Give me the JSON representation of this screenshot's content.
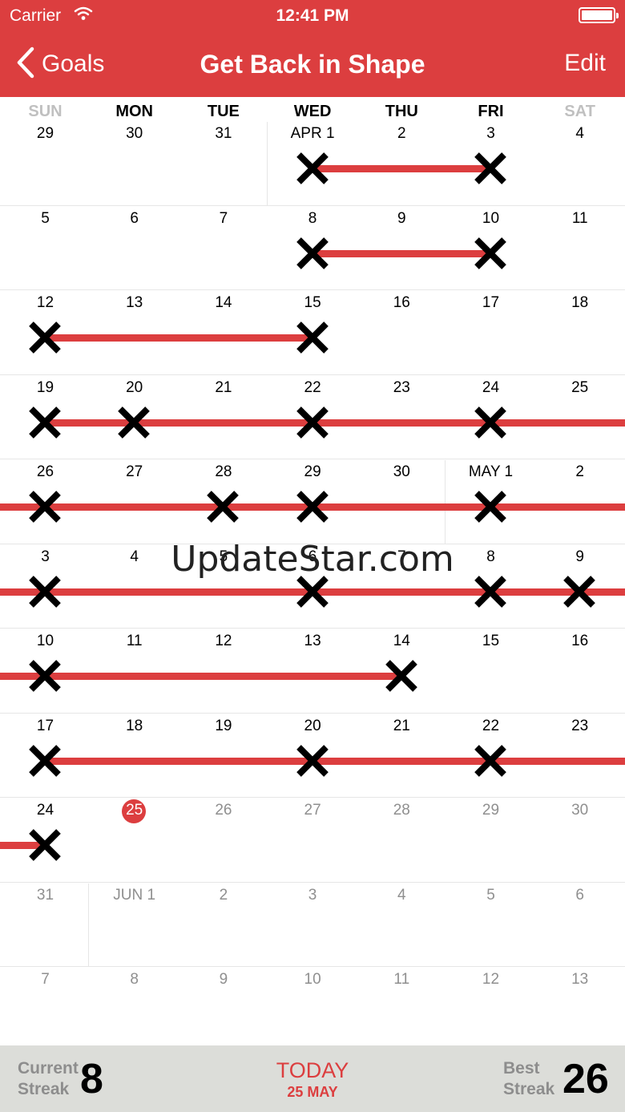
{
  "status_bar": {
    "carrier": "Carrier",
    "time": "12:41 PM"
  },
  "nav": {
    "back_label": "Goals",
    "title": "Get Back in Shape",
    "edit_label": "Edit"
  },
  "weekdays": [
    {
      "label": "SUN",
      "dim": true
    },
    {
      "label": "MON",
      "dim": false
    },
    {
      "label": "TUE",
      "dim": false
    },
    {
      "label": "WED",
      "dim": false
    },
    {
      "label": "THU",
      "dim": false
    },
    {
      "label": "FRI",
      "dim": false
    },
    {
      "label": "SAT",
      "dim": true
    }
  ],
  "calendar": {
    "weeks": [
      {
        "days": [
          "29",
          "30",
          "31",
          "APR 1",
          "2",
          "3",
          "4"
        ],
        "future": [
          false,
          false,
          false,
          false,
          false,
          false,
          false
        ],
        "marked": [
          false,
          false,
          false,
          true,
          false,
          true,
          false
        ]
      },
      {
        "days": [
          "5",
          "6",
          "7",
          "8",
          "9",
          "10",
          "11"
        ],
        "future": [
          false,
          false,
          false,
          false,
          false,
          false,
          false
        ],
        "marked": [
          false,
          false,
          false,
          true,
          false,
          true,
          false
        ]
      },
      {
        "days": [
          "12",
          "13",
          "14",
          "15",
          "16",
          "17",
          "18"
        ],
        "future": [
          false,
          false,
          false,
          false,
          false,
          false,
          false
        ],
        "marked": [
          true,
          false,
          false,
          true,
          false,
          false,
          false
        ]
      },
      {
        "days": [
          "19",
          "20",
          "21",
          "22",
          "23",
          "24",
          "25"
        ],
        "future": [
          false,
          false,
          false,
          false,
          false,
          false,
          false
        ],
        "marked": [
          true,
          true,
          false,
          true,
          false,
          true,
          false
        ]
      },
      {
        "days": [
          "26",
          "27",
          "28",
          "29",
          "30",
          "MAY 1",
          "2"
        ],
        "future": [
          false,
          false,
          false,
          false,
          false,
          false,
          false
        ],
        "marked": [
          true,
          false,
          true,
          true,
          false,
          true,
          false
        ]
      },
      {
        "days": [
          "3",
          "4",
          "5",
          "6",
          "7",
          "8",
          "9"
        ],
        "future": [
          false,
          false,
          false,
          false,
          false,
          false,
          false
        ],
        "marked": [
          true,
          false,
          false,
          true,
          false,
          true,
          true
        ]
      },
      {
        "days": [
          "10",
          "11",
          "12",
          "13",
          "14",
          "15",
          "16"
        ],
        "future": [
          false,
          false,
          false,
          false,
          false,
          false,
          false
        ],
        "marked": [
          true,
          false,
          false,
          false,
          true,
          false,
          false
        ]
      },
      {
        "days": [
          "17",
          "18",
          "19",
          "20",
          "21",
          "22",
          "23"
        ],
        "future": [
          false,
          false,
          false,
          false,
          false,
          false,
          false
        ],
        "marked": [
          true,
          false,
          false,
          true,
          false,
          true,
          false
        ]
      },
      {
        "days": [
          "24",
          "25",
          "26",
          "27",
          "28",
          "29",
          "30"
        ],
        "future": [
          false,
          false,
          true,
          true,
          true,
          true,
          true
        ],
        "marked": [
          true,
          false,
          false,
          false,
          false,
          false,
          false
        ],
        "today_index": 1
      },
      {
        "days": [
          "31",
          "JUN 1",
          "2",
          "3",
          "4",
          "5",
          "6"
        ],
        "future": [
          true,
          true,
          true,
          true,
          true,
          true,
          true
        ],
        "marked": [
          false,
          false,
          false,
          false,
          false,
          false,
          false
        ]
      },
      {
        "days": [
          "7",
          "8",
          "9",
          "10",
          "11",
          "12",
          "13"
        ],
        "future": [
          true,
          true,
          true,
          true,
          true,
          true,
          true
        ],
        "marked": [
          false,
          false,
          false,
          false,
          false,
          false,
          false
        ]
      }
    ],
    "streaks": [
      {
        "week": 0,
        "from": 3,
        "to": 5
      },
      {
        "week": 1,
        "from": 3,
        "to": 5
      },
      {
        "week": 2,
        "from": 0,
        "to": 3
      },
      {
        "week": 3,
        "from": 0,
        "to": 7
      },
      {
        "week": 4,
        "from": -1,
        "to": 7
      },
      {
        "week": 5,
        "from": -1,
        "to": 7
      },
      {
        "week": 6,
        "from": -1,
        "to": 4
      },
      {
        "week": 7,
        "from": 0,
        "to": 7
      },
      {
        "week": 8,
        "from": -1,
        "to": 0
      }
    ]
  },
  "watermark": "UpdateStar.com",
  "footer": {
    "current_label_1": "Current",
    "current_label_2": "Streak",
    "current_value": "8",
    "today_label": "TODAY",
    "today_date": "25 MAY",
    "best_label_1": "Best",
    "best_label_2": "Streak",
    "best_value": "26"
  },
  "colors": {
    "accent": "#dc3e3f",
    "footer_bg": "#dcddd9",
    "future_text": "#8f8f8f"
  },
  "icons": {
    "back": "chevron-left-icon",
    "wifi": "wifi-icon",
    "battery": "battery-icon",
    "mark": "x-mark-icon"
  }
}
